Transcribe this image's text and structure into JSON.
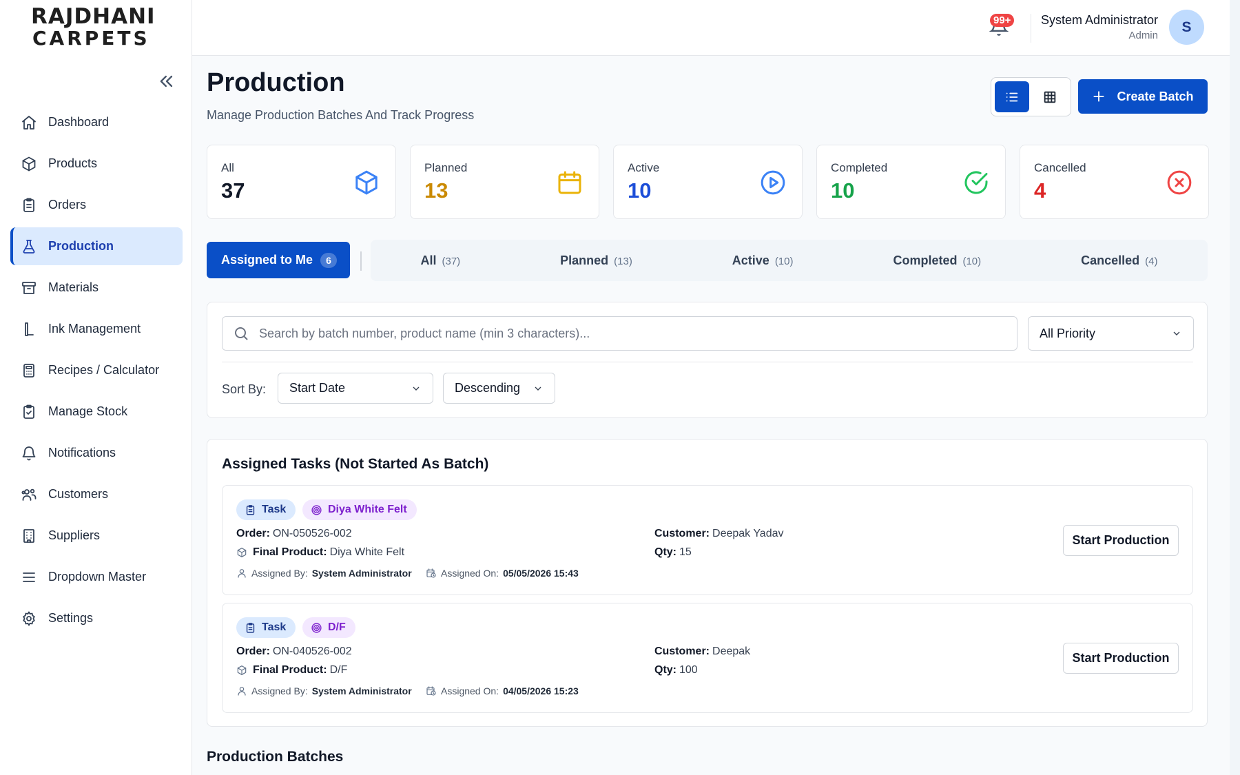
{
  "brand": {
    "line1": "RAJDHANI",
    "line2": "CARPETS"
  },
  "sidebar": {
    "items": [
      {
        "label": "Dashboard",
        "icon": "home-icon"
      },
      {
        "label": "Products",
        "icon": "box-icon"
      },
      {
        "label": "Orders",
        "icon": "clipboard-icon"
      },
      {
        "label": "Production",
        "icon": "flask-icon",
        "active": true
      },
      {
        "label": "Materials",
        "icon": "archive-icon"
      },
      {
        "label": "Ink Management",
        "icon": "ink-icon"
      },
      {
        "label": "Recipes / Calculator",
        "icon": "calculator-icon"
      },
      {
        "label": "Manage Stock",
        "icon": "clipboard-check-icon"
      },
      {
        "label": "Notifications",
        "icon": "bell-icon"
      },
      {
        "label": "Customers",
        "icon": "users-icon"
      },
      {
        "label": "Suppliers",
        "icon": "building-icon"
      },
      {
        "label": "Dropdown Master",
        "icon": "menu-icon"
      },
      {
        "label": "Settings",
        "icon": "gear-icon"
      }
    ]
  },
  "header": {
    "notification_count": "99+",
    "user_name": "System Administrator",
    "user_role": "Admin",
    "avatar_initial": "S"
  },
  "page": {
    "title": "Production",
    "subtitle": "Manage Production Batches And Track Progress",
    "create_label": "Create Batch"
  },
  "stats": [
    {
      "label": "All",
      "value": "37",
      "color": "#111827",
      "icon": "box-icon",
      "icon_color": "#3b82f6"
    },
    {
      "label": "Planned",
      "value": "13",
      "color": "#ca8a04",
      "icon": "calendar-icon",
      "icon_color": "#eab308"
    },
    {
      "label": "Active",
      "value": "10",
      "color": "#1d4ed8",
      "icon": "play-circle-icon",
      "icon_color": "#3b82f6"
    },
    {
      "label": "Completed",
      "value": "10",
      "color": "#16a34a",
      "icon": "check-circle-icon",
      "icon_color": "#22c55e"
    },
    {
      "label": "Cancelled",
      "value": "4",
      "color": "#dc2626",
      "icon": "x-circle-icon",
      "icon_color": "#ef4444"
    }
  ],
  "assigned": {
    "label": "Assigned to Me",
    "count": "6"
  },
  "tabs": [
    {
      "label": "All",
      "count": "(37)"
    },
    {
      "label": "Planned",
      "count": "(13)"
    },
    {
      "label": "Active",
      "count": "(10)"
    },
    {
      "label": "Completed",
      "count": "(10)"
    },
    {
      "label": "Cancelled",
      "count": "(4)"
    }
  ],
  "filters": {
    "search_placeholder": "Search by batch number, product name (min 3 characters)...",
    "priority": "All Priority",
    "sort_label": "Sort By:",
    "sort_field": "Start Date",
    "sort_order": "Descending"
  },
  "tasks_section": {
    "title": "Assigned Tasks (Not Started As Batch)",
    "field_labels": {
      "order": "Order:",
      "final_product": "Final Product:",
      "customer": "Customer:",
      "qty": "Qty:",
      "assigned_by": "Assigned By:",
      "assigned_on": "Assigned On:"
    },
    "tasks": [
      {
        "tag": "Task",
        "product_tag": "Diya White Felt",
        "order": "ON-050526-002",
        "final_product": "Diya White Felt",
        "customer": "Deepak Yadav",
        "qty": "15",
        "assigned_by": "System Administrator",
        "assigned_on": "05/05/2026 15:43",
        "button": "Start Production"
      },
      {
        "tag": "Task",
        "product_tag": "D/F",
        "order": "ON-040526-002",
        "final_product": "D/F",
        "customer": "Deepak",
        "qty": "100",
        "assigned_by": "System Administrator",
        "assigned_on": "04/05/2026 15:23",
        "button": "Start Production"
      }
    ]
  },
  "batches_title": "Production Batches"
}
